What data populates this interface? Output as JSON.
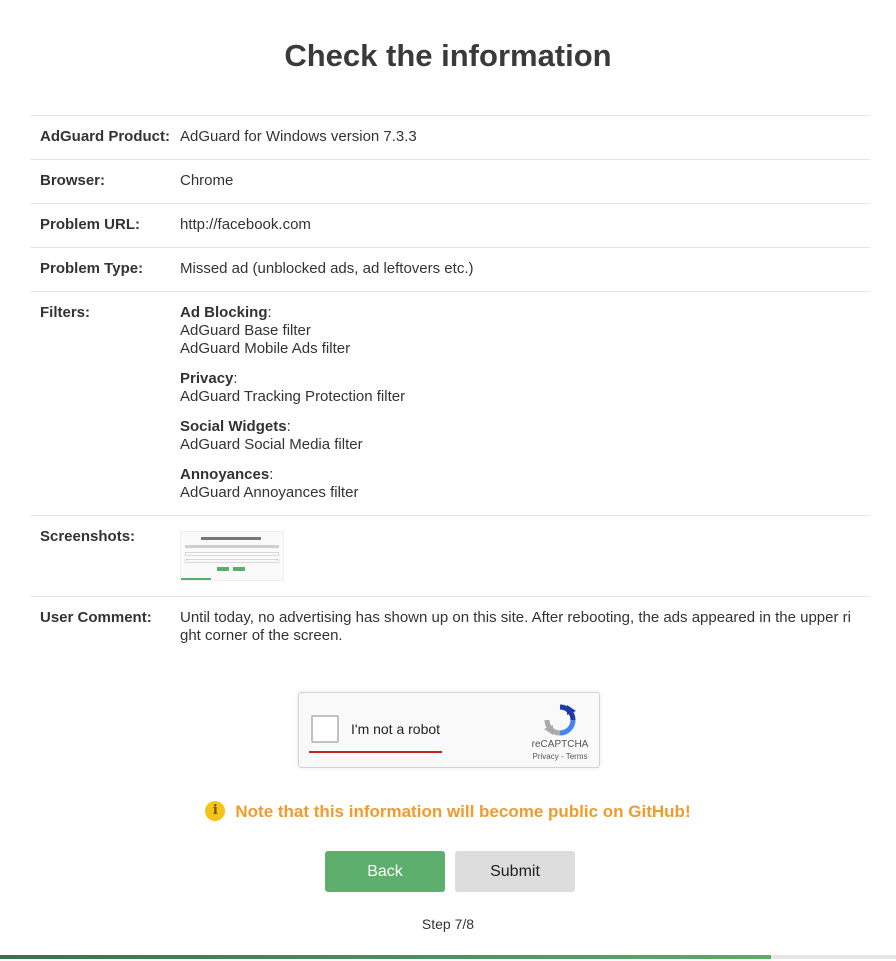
{
  "page": {
    "title": "Check the information"
  },
  "details": {
    "product": {
      "label": "AdGuard Product:",
      "value": "AdGuard for Windows version 7.3.3"
    },
    "browser": {
      "label": "Browser:",
      "value": "Chrome"
    },
    "url": {
      "label": "Problem URL:",
      "value": "http://facebook.com"
    },
    "type": {
      "label": "Problem Type:",
      "value": "Missed ad (unblocked ads, ad leftovers etc.)"
    },
    "filters": {
      "label": "Filters:",
      "groups": [
        {
          "category": "Ad Blocking",
          "items": [
            "AdGuard Base filter",
            "AdGuard Mobile Ads filter"
          ]
        },
        {
          "category": "Privacy",
          "items": [
            "AdGuard Tracking Protection filter"
          ]
        },
        {
          "category": "Social Widgets",
          "items": [
            "AdGuard Social Media filter"
          ]
        },
        {
          "category": "Annoyances",
          "items": [
            "AdGuard Annoyances filter"
          ]
        }
      ]
    },
    "screenshots": {
      "label": "Screenshots:"
    },
    "comment": {
      "label": "User Comment:",
      "value": "Until today, no advertising has shown up on this site. After rebooting, the ads appeared in the upper right corner of the screen."
    }
  },
  "captcha": {
    "label": "I'm not a robot",
    "brand": "reCAPTCHA",
    "privacy": "Privacy",
    "separator": " - ",
    "terms": "Terms"
  },
  "notice": {
    "icon": "info-icon",
    "icon_glyph": "i",
    "text": "Note that this information will become public on GitHub!"
  },
  "buttons": {
    "back": "Back",
    "submit": "Submit"
  },
  "progress": {
    "step_text": "Step 7/8",
    "fraction": 0.86
  },
  "colors": {
    "accent_green": "#5eae6e",
    "notice_orange": "#f19a2e",
    "captcha_underline": "#c0261f"
  }
}
